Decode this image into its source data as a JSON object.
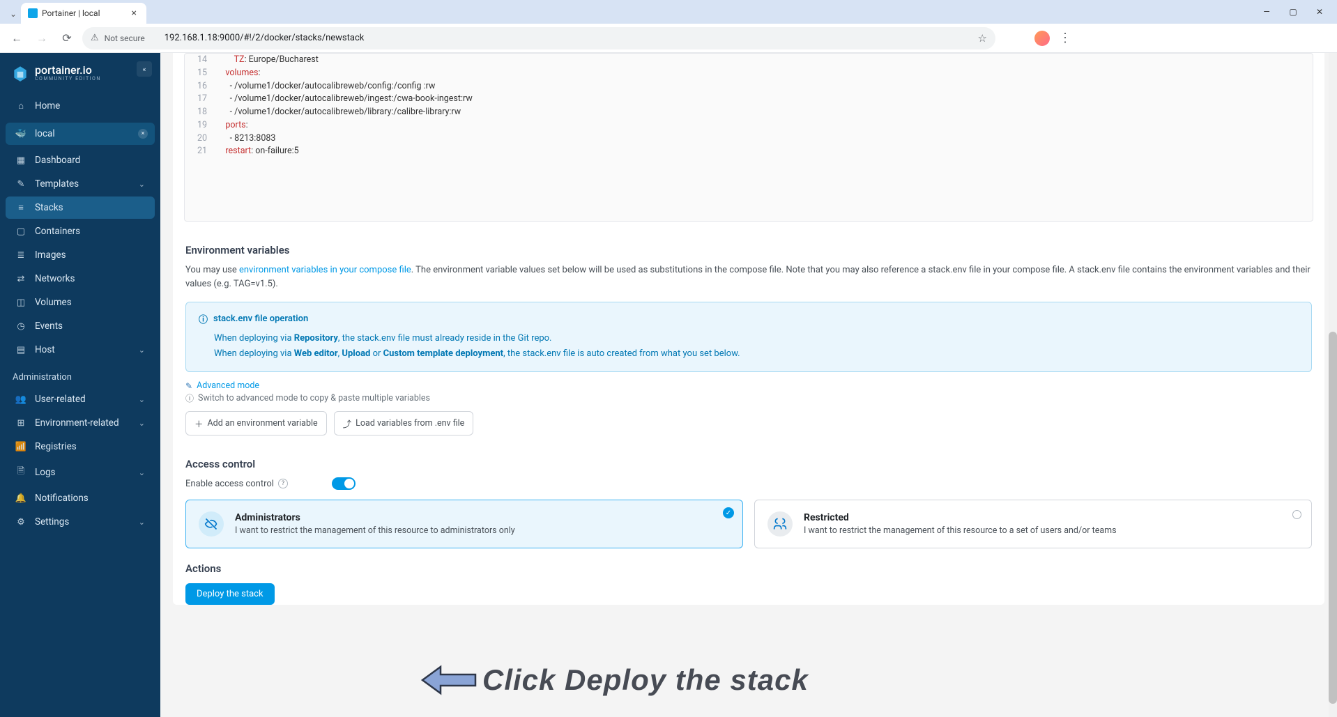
{
  "browser": {
    "tab_title": "Portainer | local",
    "not_secure": "Not secure",
    "url": "192.168.1.18:9000/#!/2/docker/stacks/newstack"
  },
  "sidebar": {
    "brand": "portainer.io",
    "brand_sub": "COMMUNITY EDITION",
    "home": "Home",
    "env_name": "local",
    "items": [
      "Dashboard",
      "Templates",
      "Stacks",
      "Containers",
      "Images",
      "Networks",
      "Volumes",
      "Events",
      "Host"
    ],
    "admin_header": "Administration",
    "admin_items": [
      "User-related",
      "Environment-related",
      "Registries",
      "Logs",
      "Notifications",
      "Settings"
    ]
  },
  "code": {
    "lines": [
      {
        "n": "14",
        "indent": "        ",
        "key": "TZ",
        "val": ": Europe/Bucharest"
      },
      {
        "n": "15",
        "indent": "    ",
        "key": "volumes",
        "val": ":"
      },
      {
        "n": "16",
        "indent": "      - ",
        "key": "",
        "val": "/volume1/docker/autocalibreweb/config:/config :rw"
      },
      {
        "n": "17",
        "indent": "      - ",
        "key": "",
        "val": "/volume1/docker/autocalibreweb/ingest:/cwa-book-ingest:rw"
      },
      {
        "n": "18",
        "indent": "      - ",
        "key": "",
        "val": "/volume1/docker/autocalibreweb/library:/calibre-library:rw"
      },
      {
        "n": "19",
        "indent": "    ",
        "key": "ports",
        "val": ":"
      },
      {
        "n": "20",
        "indent": "      - ",
        "key": "",
        "val": "8213:8083"
      },
      {
        "n": "21",
        "indent": "    ",
        "key": "restart",
        "val": ": on-failure:5"
      }
    ]
  },
  "env": {
    "heading": "Environment variables",
    "help_pre": "You may use ",
    "help_link": "environment variables in your compose file",
    "help_post": ". The environment variable values set below will be used as substitutions in the compose file. Note that you may also reference a stack.env file in your compose file. A stack.env file contains the environment variables and their values (e.g. TAG=v1.5).",
    "info_title": "stack.env file operation",
    "info_l1_a": "When deploying via ",
    "info_l1_b": "Repository",
    "info_l1_c": ", the stack.env file must already reside in the Git repo.",
    "info_l2_a": "When deploying via ",
    "info_l2_b": "Web editor",
    "info_l2_c": ", ",
    "info_l2_d": "Upload",
    "info_l2_e": " or ",
    "info_l2_f": "Custom template deployment",
    "info_l2_g": ", the stack.env file is auto created from what you set below.",
    "adv_mode": "Advanced mode",
    "adv_hint": "Switch to advanced mode to copy & paste multiple variables",
    "btn_add": "Add an environment variable",
    "btn_load": "Load variables from .env file"
  },
  "access": {
    "heading": "Access control",
    "enable_label": "Enable access control",
    "card1_title": "Administrators",
    "card1_desc": "I want to restrict the management of this resource to administrators only",
    "card2_title": "Restricted",
    "card2_desc": "I want to restrict the management of this resource to a set of users and/or teams"
  },
  "actions": {
    "heading": "Actions",
    "deploy": "Deploy the stack"
  },
  "annotation": "Click Deploy the stack"
}
